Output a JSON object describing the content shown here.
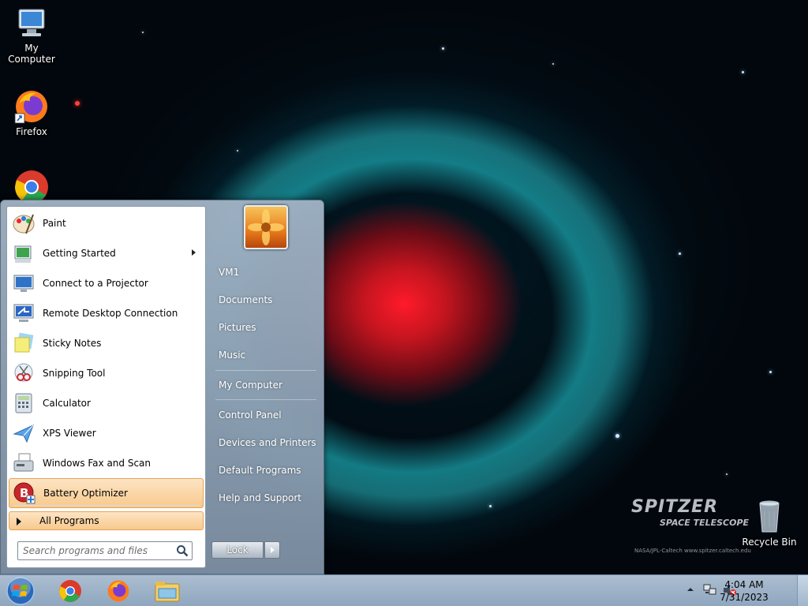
{
  "desktop": {
    "icons": [
      {
        "label": "My Computer",
        "icon": "computer-icon"
      },
      {
        "label": "Firefox",
        "icon": "firefox-icon"
      },
      {
        "label": "",
        "icon": "chrome-icon"
      },
      {
        "label": "Recycle Bin",
        "icon": "recycle-bin-icon"
      }
    ],
    "wallpaper_text": {
      "brand": "SPITZER",
      "subtitle": "SPACE TELESCOPE",
      "credit": "NASA/JPL-Caltech     www.spitzer.caltech.edu"
    }
  },
  "start_menu": {
    "programs": [
      {
        "label": "Paint",
        "icon": "paint-icon"
      },
      {
        "label": "Getting Started",
        "icon": "getting-started-icon",
        "submenu": true
      },
      {
        "label": "Connect to a Projector",
        "icon": "projector-icon"
      },
      {
        "label": "Remote Desktop Connection",
        "icon": "remote-desktop-icon"
      },
      {
        "label": "Sticky Notes",
        "icon": "sticky-notes-icon"
      },
      {
        "label": "Snipping Tool",
        "icon": "snipping-tool-icon"
      },
      {
        "label": "Calculator",
        "icon": "calculator-icon"
      },
      {
        "label": "XPS Viewer",
        "icon": "xps-viewer-icon"
      },
      {
        "label": "Windows Fax and Scan",
        "icon": "fax-scan-icon"
      },
      {
        "label": "Battery Optimizer",
        "icon": "battery-optimizer-icon",
        "highlighted": true
      }
    ],
    "all_programs": "All Programs",
    "search_placeholder": "Search programs and files",
    "right_items": {
      "user": "VM1",
      "documents": "Documents",
      "pictures": "Pictures",
      "music": "Music",
      "computer": "My Computer",
      "control_panel": "Control Panel",
      "devices": "Devices and Printers",
      "defaults": "Default Programs",
      "help": "Help and Support"
    },
    "lock_label": "Lock"
  },
  "taskbar": {
    "pinned": [
      "chrome-icon",
      "firefox-icon",
      "file-explorer-icon"
    ],
    "clock_time": "4:04 AM",
    "clock_date": "7/31/2023"
  },
  "colors": {
    "highlight": "#f8c98c",
    "taskbar": "#a9c0d8"
  }
}
